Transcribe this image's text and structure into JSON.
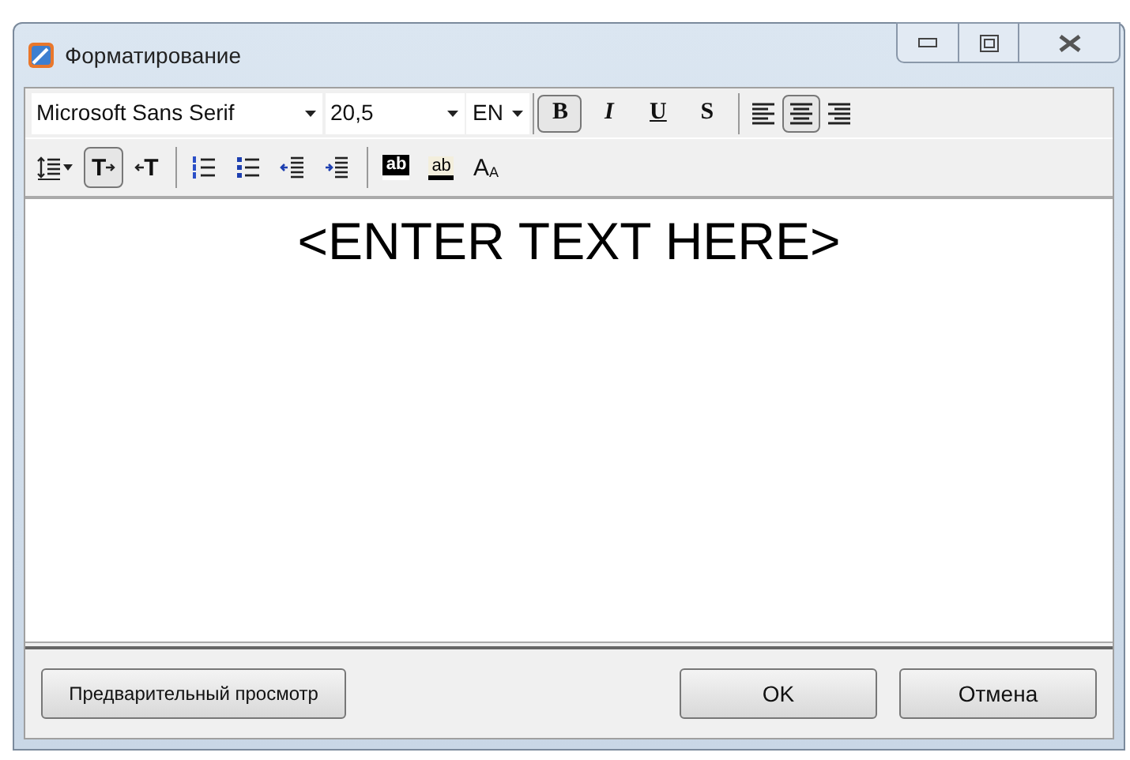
{
  "window": {
    "title": "Форматирование"
  },
  "font_toolbar": {
    "font": "Microsoft Sans Serif",
    "size": "20,5",
    "language": "EN",
    "style_buttons": [
      {
        "kind": "bold",
        "label": "B",
        "on": true
      },
      {
        "kind": "italic",
        "label": "I",
        "on": false
      },
      {
        "kind": "underline",
        "label": "U",
        "on": false
      },
      {
        "kind": "strike",
        "label": "S",
        "on": false
      }
    ],
    "align_buttons": [
      {
        "kind": "left",
        "selected": false
      },
      {
        "kind": "center",
        "selected": true
      },
      {
        "kind": "right",
        "selected": false
      }
    ]
  },
  "format_toolbar": {
    "tools": [
      {
        "kind": "line-spacing",
        "on": false
      },
      {
        "kind": "text-forward",
        "label": "T",
        "on": true
      },
      {
        "kind": "text-back",
        "label": "T",
        "on": false
      },
      {
        "kind": "numbered-list",
        "on": false
      },
      {
        "kind": "bullet-list",
        "on": false
      },
      {
        "kind": "outdent",
        "on": false
      },
      {
        "kind": "indent",
        "on": false
      },
      {
        "kind": "highlight",
        "label": "ab",
        "on": false
      },
      {
        "kind": "text-color",
        "label": "ab",
        "on": false
      },
      {
        "kind": "font-size",
        "label": "A",
        "small_label": "A",
        "on": false
      }
    ]
  },
  "editor": {
    "text": "<ENTER TEXT HERE>"
  },
  "buttons": [
    {
      "label": "Предварительный просмотр"
    },
    {
      "label": "OK"
    },
    {
      "label": "Отмена"
    }
  ]
}
